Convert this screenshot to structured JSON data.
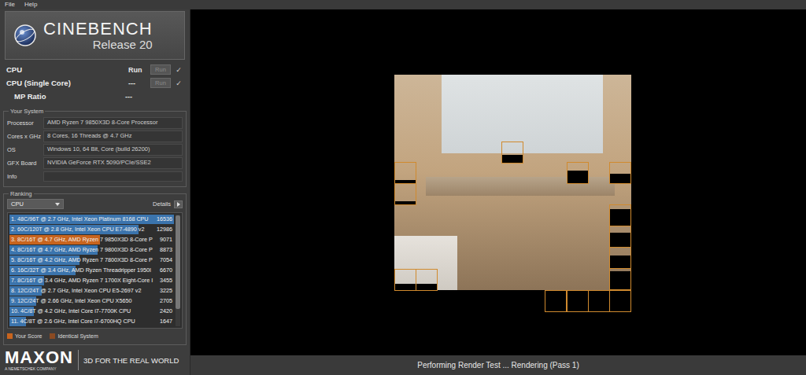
{
  "menu": [
    "File",
    "Help"
  ],
  "logo": {
    "title": "CINEBENCH",
    "subtitle": "Release 20"
  },
  "benchmarks": [
    {
      "label": "CPU",
      "value": "Run",
      "button": "Run",
      "disabled": true,
      "check": "✓",
      "kind": "test"
    },
    {
      "label": "CPU (Single Core)",
      "value": "---",
      "button": "Run",
      "disabled": true,
      "check": "✓",
      "kind": "test"
    },
    {
      "label": "MP Ratio",
      "value": "---",
      "kind": "ratio"
    }
  ],
  "system": {
    "title": "Your System",
    "rows": [
      {
        "label": "Processor",
        "value": "AMD Ryzen 7 9850X3D 8-Core Processor"
      },
      {
        "label": "Cores x GHz",
        "value": "8 Cores, 16 Threads @ 4.7 GHz"
      },
      {
        "label": "OS",
        "value": "Windows 10, 64 Bit, Core (build 26200)"
      },
      {
        "label": "GFX Board",
        "value": "NVIDIA GeForce RTX 5090/PCIe/SSE2"
      },
      {
        "label": "Info",
        "value": ""
      }
    ]
  },
  "ranking": {
    "title": "Ranking",
    "dropdown": "CPU",
    "details": "Details",
    "rows": [
      {
        "label": "1. 48C/96T @ 2.7 GHz, Intel Xeon Platinum 8168 CPU",
        "score": "16536",
        "level": 1.0,
        "color": "#3b74ad"
      },
      {
        "label": "2. 60C/120T @ 2.8 GHz, Intel Xeon CPU E7-4890 v2",
        "score": "12986",
        "level": 0.785,
        "color": "#3b74ad"
      },
      {
        "label": "3. 8C/16T @ 4.7 GHz, AMD Ryzen 7 9850X3D 8-Core P",
        "score": "9071",
        "level": 0.549,
        "color": "#c8641e"
      },
      {
        "label": "4. 8C/16T @ 4.7 GHz, AMD Ryzen 7 9800X3D 8-Core P",
        "score": "8873",
        "level": 0.537,
        "color": "#3b74ad"
      },
      {
        "label": "5. 8C/16T @ 4.2 GHz, AMD Ryzen 7 7800X3D 8-Core P",
        "score": "7054",
        "level": 0.427,
        "color": "#3b74ad"
      },
      {
        "label": "6. 16C/32T @ 3.4 GHz, AMD Ryzen Threadripper 1950I",
        "score": "6670",
        "level": 0.403,
        "color": "#3b74ad"
      },
      {
        "label": "7. 8C/16T @ 3.4 GHz, AMD Ryzen 7 1700X Eight-Core I",
        "score": "3455",
        "level": 0.209,
        "color": "#3b74ad"
      },
      {
        "label": "8. 12C/24T @ 2.7 GHz, Intel Xeon CPU E5-2697 v2",
        "score": "3225",
        "level": 0.195,
        "color": "#3b74ad"
      },
      {
        "label": "9. 12C/24T @ 2.66 GHz, Intel Xeon CPU X5650",
        "score": "2705",
        "level": 0.164,
        "color": "#3b74ad"
      },
      {
        "label": "10. 4C/8T @ 4.2 GHz, Intel Core i7-7700K CPU",
        "score": "2420",
        "level": 0.146,
        "color": "#3b74ad"
      },
      {
        "label": "11. 4C/8T @ 2.6 GHz, Intel Core i7-6700HQ CPU",
        "score": "1647",
        "level": 0.1,
        "color": "#3b74ad"
      }
    ],
    "legend": [
      {
        "label": "Your Score",
        "color": "#c8641e"
      },
      {
        "label": "Identical System",
        "color": "#8a4a22"
      }
    ]
  },
  "footer": {
    "brand": "MAXON",
    "company": "A NEMETSCHEK COMPANY",
    "slogan": "3D FOR THE REAL WORLD"
  },
  "render": {
    "status": "Performing Render Test ... Rendering (Pass 1)"
  }
}
